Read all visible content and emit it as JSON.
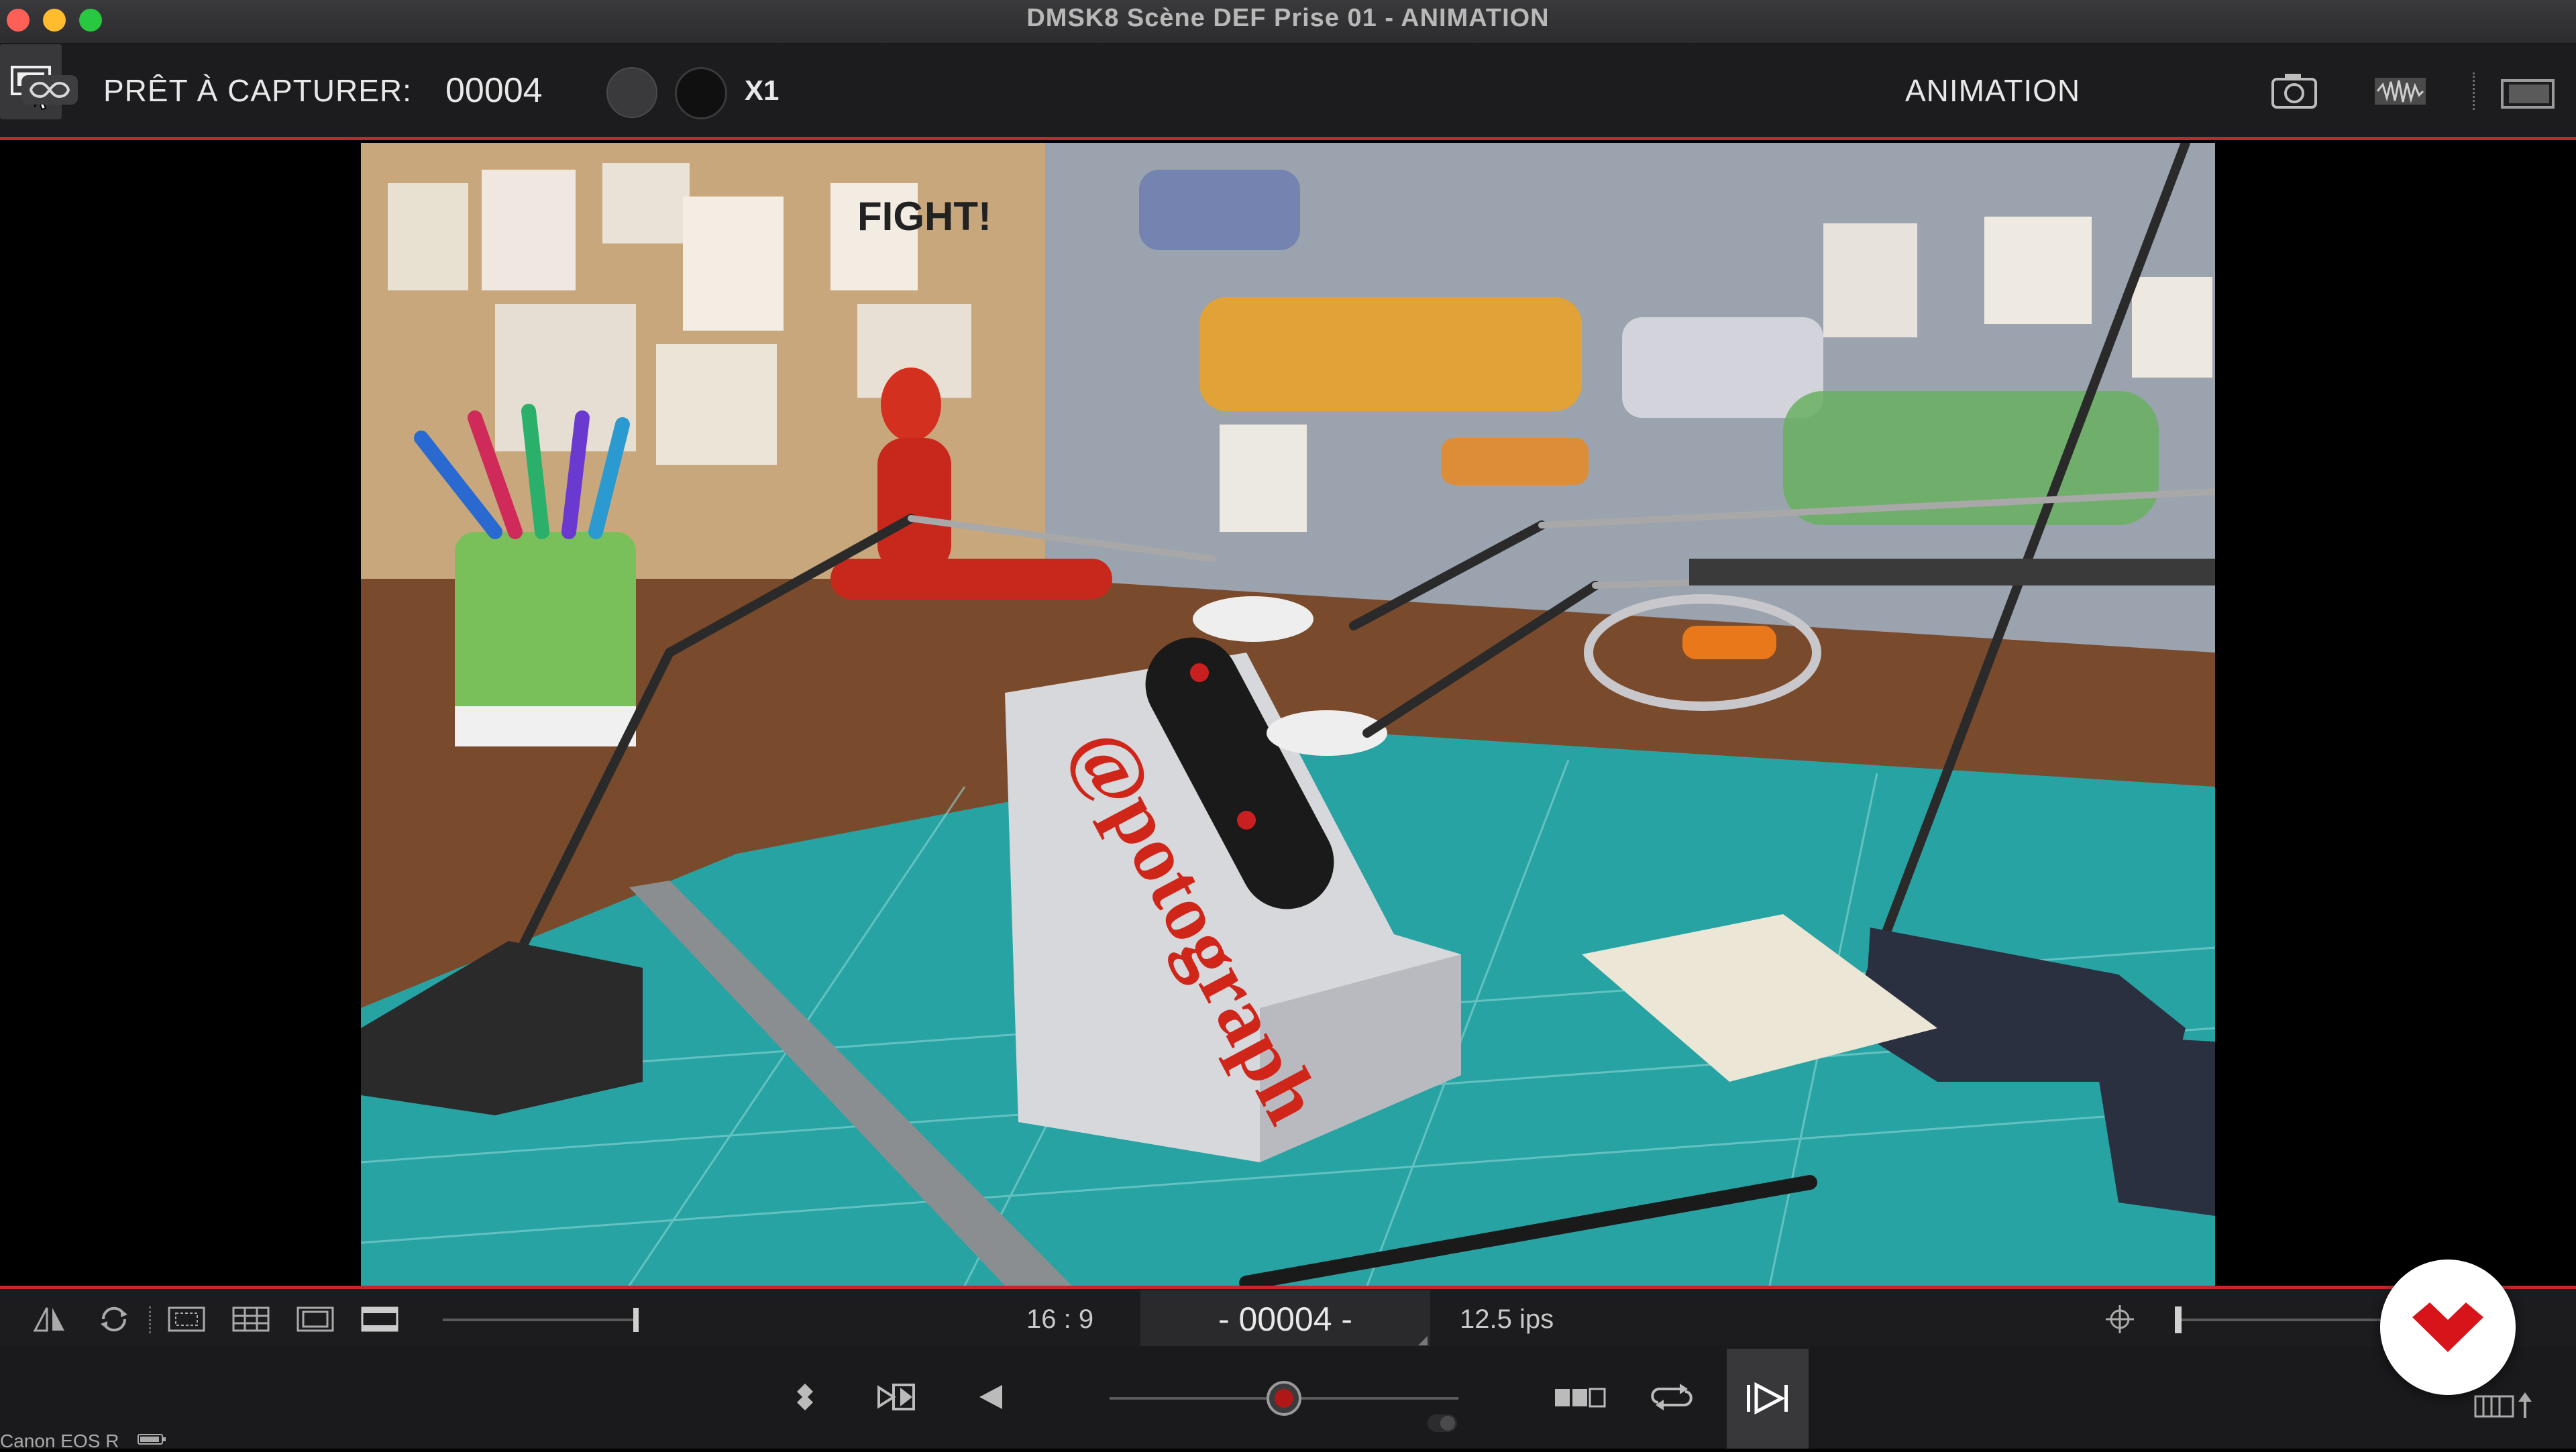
{
  "window": {
    "title": "DMSK8  Scène DEF  Prise 01 - ANIMATION"
  },
  "toolbar": {
    "ready_label": "PRÊT À CAPTURER:",
    "frame_counter": "00004",
    "speed_label": "X1",
    "mode_label": "ANIMATION",
    "icons": [
      "loop-icon",
      "monitor-icon",
      "camera-icon",
      "audio-waveform-icon",
      "window-layout-icon"
    ]
  },
  "viewer": {
    "description_icons": [
      "live-view-frame"
    ]
  },
  "bottom_strip": {
    "aspect_ratio": "16 : 9",
    "frame_display": "- 00004 -",
    "fps": "12.5 ips",
    "icons": [
      "flip-icon",
      "rotate-icon",
      "safe-area-icon",
      "grid-icon",
      "frame-guide-icon",
      "letterbox-icon",
      "crosshair-icon"
    ]
  },
  "transport": {
    "camera_model": "Canon EOS R",
    "icons": [
      "keyframe-icon",
      "mirror-icon",
      "step-back-icon",
      "shuttle-slider",
      "onion-skin-icon",
      "loop-playback-icon",
      "live-view-icon",
      "timeline-export-icon"
    ]
  },
  "colors": {
    "accent_red": "#c62828",
    "background": "#1c1c1e",
    "brand_red": "#d7141a"
  }
}
